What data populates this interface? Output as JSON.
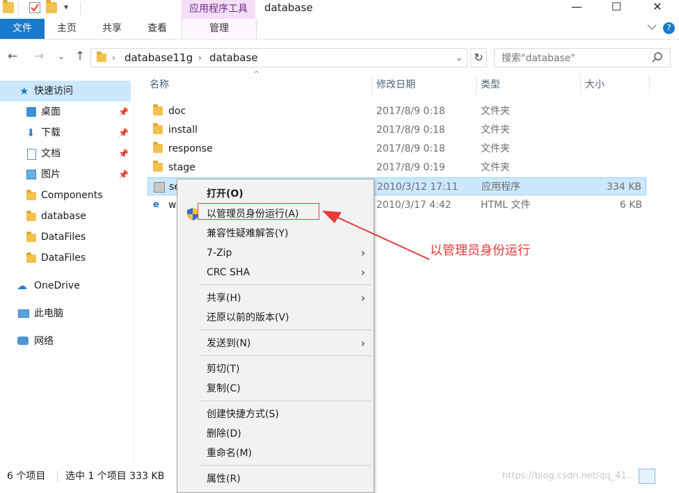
{
  "window": {
    "title": "database",
    "contextual_tab_group": "应用程序工具",
    "controls": {
      "minimize": "—",
      "maximize": "☐",
      "close": "✕"
    }
  },
  "ribbon": {
    "tabs": [
      "文件",
      "主页",
      "共享",
      "查看",
      "管理"
    ],
    "expand_icon": "chevron-down-icon",
    "help_icon": "help-icon",
    "help_glyph": "?"
  },
  "address": {
    "crumbs": [
      "database11g",
      "database"
    ],
    "refresh_glyph": "↻",
    "search_placeholder": "搜索\"database\""
  },
  "nav": {
    "quick_access": "快速访问",
    "items": [
      {
        "label": "桌面",
        "icon": "desktop-icon",
        "pinned": true
      },
      {
        "label": "下载",
        "icon": "download-icon",
        "pinned": true
      },
      {
        "label": "文档",
        "icon": "document-icon",
        "pinned": true
      },
      {
        "label": "图片",
        "icon": "pictures-icon",
        "pinned": true
      },
      {
        "label": "Components",
        "icon": "folder-icon",
        "pinned": false
      },
      {
        "label": "database",
        "icon": "folder-icon",
        "pinned": false
      },
      {
        "label": "DataFiles",
        "icon": "folder-icon",
        "pinned": false
      },
      {
        "label": "DataFiles",
        "icon": "folder-icon",
        "pinned": false
      }
    ],
    "onedrive": "OneDrive",
    "this_pc": "此电脑",
    "network": "网络"
  },
  "columns": {
    "name": "名称",
    "date": "修改日期",
    "type": "类型",
    "size": "大小"
  },
  "files": [
    {
      "name": "doc",
      "date": "2017/8/9 0:18",
      "type": "文件夹",
      "size": "",
      "icon": "folder-icon"
    },
    {
      "name": "install",
      "date": "2017/8/9 0:18",
      "type": "文件夹",
      "size": "",
      "icon": "folder-icon"
    },
    {
      "name": "response",
      "date": "2017/8/9 0:18",
      "type": "文件夹",
      "size": "",
      "icon": "folder-icon"
    },
    {
      "name": "stage",
      "date": "2017/8/9 0:19",
      "type": "文件夹",
      "size": "",
      "icon": "folder-icon"
    },
    {
      "name": "se",
      "date": "2010/3/12 17:11",
      "type": "应用程序",
      "size": "334 KB",
      "icon": "installer-icon"
    },
    {
      "name": "w",
      "date": "2010/3/17 4:42",
      "type": "HTML 文件",
      "size": "6 KB",
      "icon": "ie-html-icon"
    }
  ],
  "context_menu": {
    "open": "打开(O)",
    "run_as_admin": "以管理员身份运行(A)",
    "compat": "兼容性疑难解答(Y)",
    "zip": "7-Zip",
    "crc": "CRC SHA",
    "share": "共享(H)",
    "restore": "还原以前的版本(V)",
    "send_to": "发送到(N)",
    "cut": "剪切(T)",
    "copy": "复制(C)",
    "shortcut": "创建快捷方式(S)",
    "delete": "删除(D)",
    "rename": "重命名(M)",
    "properties": "属性(R)",
    "submenu_glyph": "›"
  },
  "annotation": "以管理员身份运行",
  "status": {
    "count": "6 个项目",
    "selection": "选中 1 个项目  333 KB"
  },
  "watermark": "https://blog.csdn.net/qq_41…",
  "colors": {
    "accent": "#1979ca",
    "selection": "#cce8ff",
    "context_tab": "#f3dff7",
    "annotation": "#e53935"
  }
}
